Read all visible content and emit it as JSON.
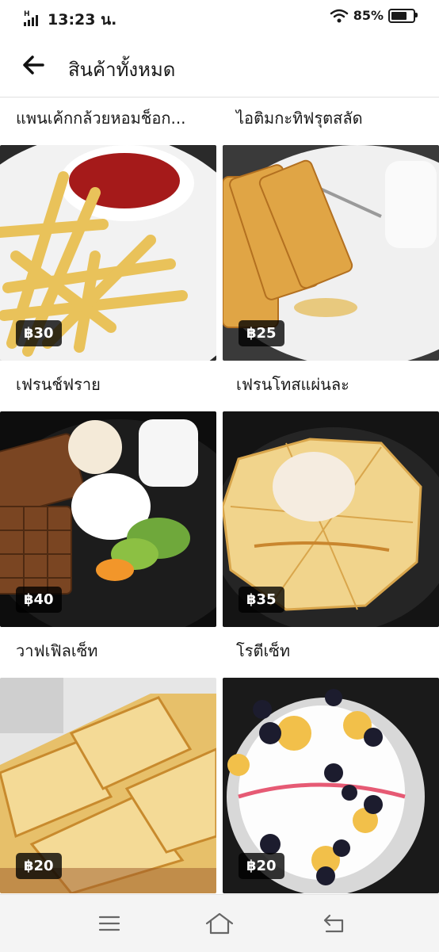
{
  "status": {
    "signal_label": "H",
    "time": "13:23 น.",
    "battery": "85%",
    "battery_level": 0.85
  },
  "header": {
    "title": "สินค้าทั้งหมด"
  },
  "top_labels": [
    "แพนเค้กกล้วยหอมช็อก...",
    "ไอติมกะทิฟรุตสลัด"
  ],
  "products": [
    {
      "name": "เฟรนช์ฟราย",
      "price": "฿30"
    },
    {
      "name": "เฟรนโทสแผ่นละ",
      "price": "฿25"
    },
    {
      "name": "วาฟเฟิลเซ็ท",
      "price": "฿40"
    },
    {
      "name": "โรตีเซ็ท",
      "price": "฿35"
    },
    {
      "name": "",
      "price": "฿20"
    },
    {
      "name": "",
      "price": "฿20"
    }
  ],
  "colors": {
    "accent": "#000000",
    "badge_bg": "#000000",
    "navbar_bg": "#f4f4f4"
  }
}
